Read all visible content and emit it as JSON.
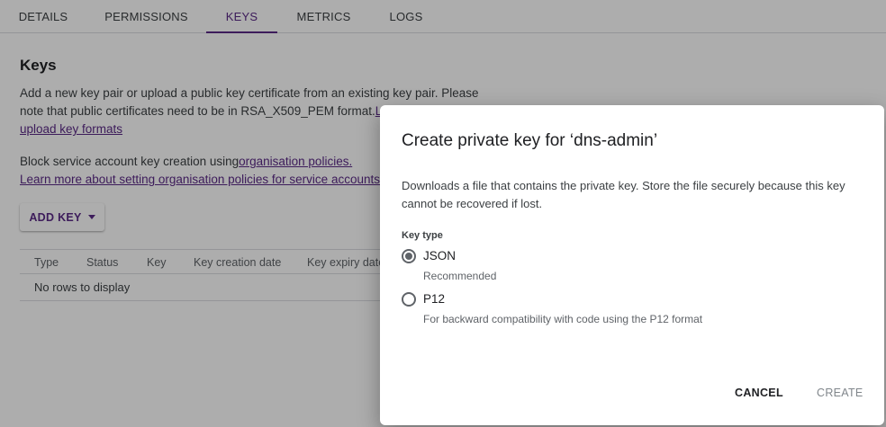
{
  "tabs": [
    {
      "label": "DETAILS"
    },
    {
      "label": "PERMISSIONS"
    },
    {
      "label": "KEYS"
    },
    {
      "label": "METRICS"
    },
    {
      "label": "LOGS"
    }
  ],
  "active_tab": "KEYS",
  "keys": {
    "title": "Keys",
    "description_text": "Add a new key pair or upload a public key certificate from an existing key pair. Please note that public certificates need to be in RSA_X509_PEM format.",
    "description_link": "Learn more about upload key formats",
    "block_text": "Block service account key creation using",
    "block_link": "organisation policies.",
    "policies_link": "Learn more about setting organisation policies for service accounts",
    "add_key_label": "ADD KEY",
    "table": {
      "columns": [
        "Type",
        "Status",
        "Key",
        "Key creation date",
        "Key expiry date"
      ],
      "empty_text": "No rows to display"
    }
  },
  "dialog": {
    "title": "Create private key for ‘dns-admin’",
    "description": "Downloads a file that contains the private key. Store the file securely because this key cannot be recovered if lost.",
    "key_type_label": "Key type",
    "options": [
      {
        "label": "JSON",
        "sub": "Recommended",
        "selected": true
      },
      {
        "label": "P12",
        "sub": "For backward compatibility with code using the P12 format",
        "selected": false
      }
    ],
    "cancel_label": "CANCEL",
    "create_label": "CREATE"
  },
  "colors": {
    "accent": "#5b2a86",
    "scrim": "rgba(0,0,0,0.32)"
  }
}
